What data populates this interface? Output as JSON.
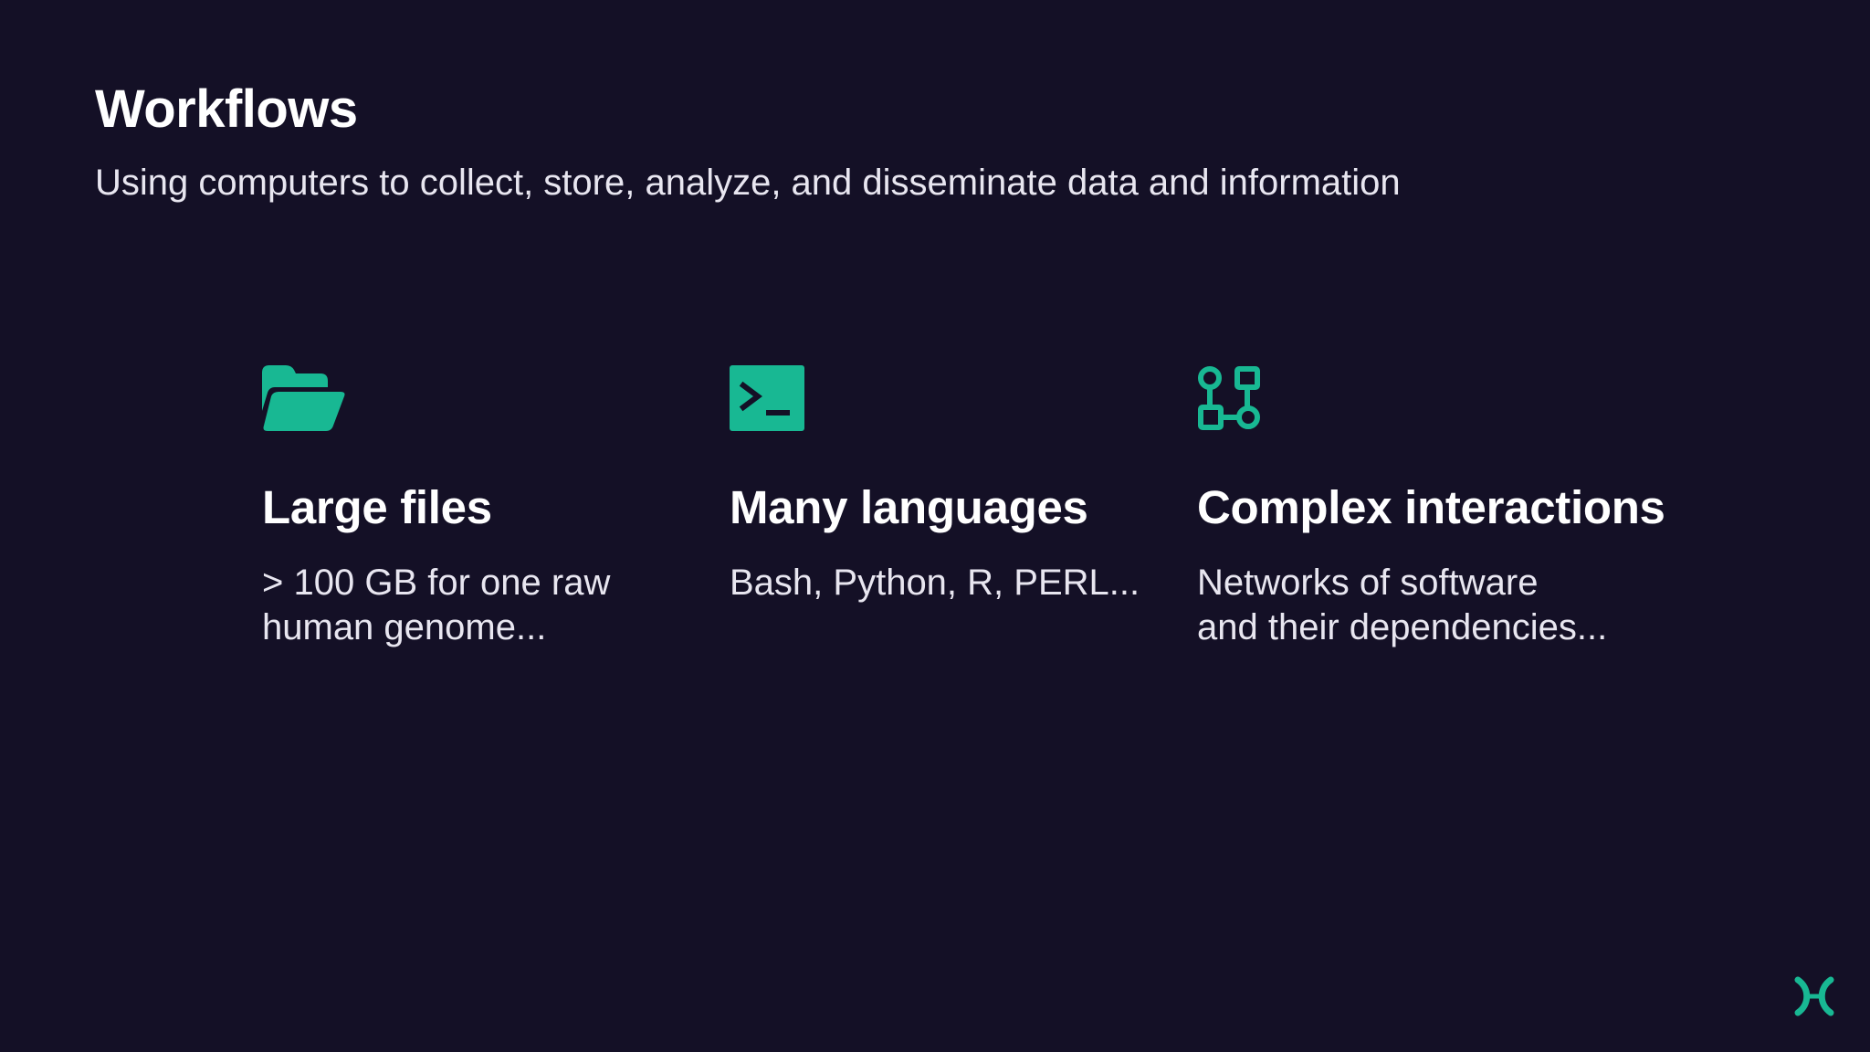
{
  "slide": {
    "title": "Workflows",
    "subtitle": "Using computers to collect, store, analyze, and disseminate data and information"
  },
  "features": [
    {
      "icon": "folder-open-icon",
      "title": "Large files",
      "description_lines": [
        "> 100 GB for one raw",
        "human genome..."
      ]
    },
    {
      "icon": "terminal-icon",
      "title": "Many languages",
      "description_lines": [
        "Bash, Python, R, PERL..."
      ]
    },
    {
      "icon": "workflow-graph-icon",
      "title": "Complex interactions",
      "description_lines": [
        "Networks of software",
        "and their dependencies..."
      ]
    }
  ],
  "branding": {
    "logo_icon": "nextflow-logo-icon"
  },
  "colors": {
    "background": "#141026",
    "accent": "#18b893",
    "text": "#ffffff",
    "text_muted": "#e8e6f0"
  }
}
